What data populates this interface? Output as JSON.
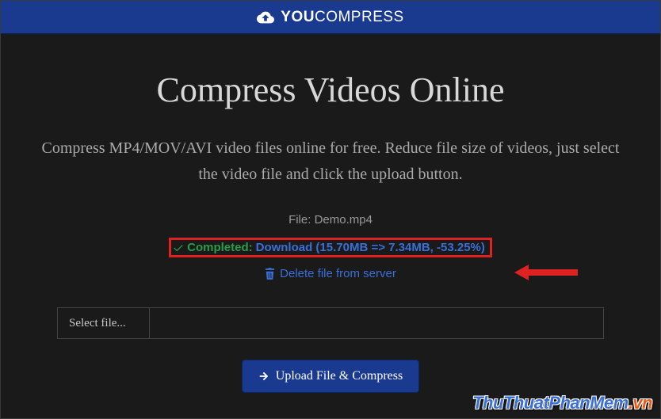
{
  "header": {
    "logo_bold": "YOU",
    "logo_light": "COMPRESS"
  },
  "main": {
    "title": "Compress Videos Online",
    "description": "Compress MP4/MOV/AVI video files online for free. Reduce file size of videos, just select the video file and click the upload button.",
    "file_label": "File: Demo.mp4",
    "completed_text": "Completed:",
    "download_text": "Download (15.70MB => 7.34MB, -53.25%)",
    "delete_text": "Delete file from server",
    "select_label": "Select file...",
    "upload_button": "Upload File & Compress"
  },
  "watermark": {
    "part1": "ThuThuatPhanMem",
    "part2": ".vn"
  }
}
